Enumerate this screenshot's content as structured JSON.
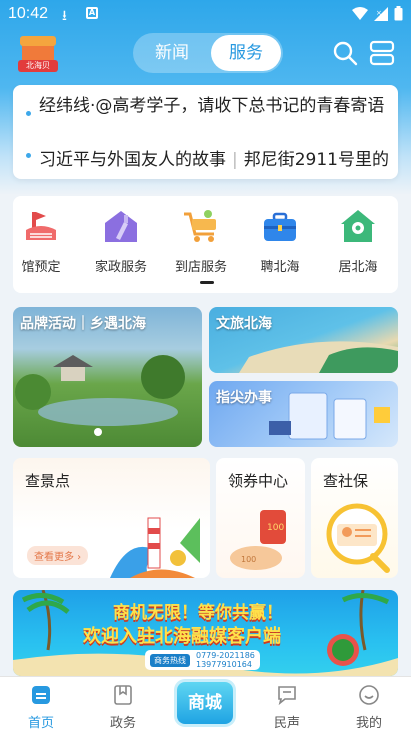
{
  "status_bar": {
    "time": "10:42"
  },
  "header": {
    "tab_news": "新闻",
    "tab_service": "服务",
    "logo_text": "北海贝"
  },
  "marquee": {
    "line1": "经纬线·@高考学子，请收下总书记的青春寄语",
    "line2a": "习近平与外国友人的故事",
    "line2b": "邦尼街2911号里的"
  },
  "services": [
    {
      "label": "馆预定",
      "icon": "venue-icon"
    },
    {
      "label": "家政服务",
      "icon": "housekeeping-icon"
    },
    {
      "label": "到店服务",
      "icon": "shopping-cart-icon"
    },
    {
      "label": "聘北海",
      "icon": "briefcase-icon"
    },
    {
      "label": "居北海",
      "icon": "house-location-icon"
    }
  ],
  "cards": {
    "brand": "品牌活动｜乡遇北海",
    "culture": "文旅北海",
    "fingertip": "指尖办事",
    "scenic": "查景点",
    "scenic_more": "查看更多",
    "coupon": "领券中心",
    "social": "查社保"
  },
  "ad": {
    "line1": "商机无限！等你共赢！",
    "line2": "欢迎入驻北海融媒客户端",
    "hotline_label": "商务热线",
    "phone1": "0779-2021186",
    "phone2": "13977910164"
  },
  "tabbar": {
    "home": "首页",
    "gov": "政务",
    "mall": "商城",
    "voice": "民声",
    "mine": "我的"
  },
  "colors": {
    "accent": "#2799e0",
    "header": "#2ea7ea"
  }
}
